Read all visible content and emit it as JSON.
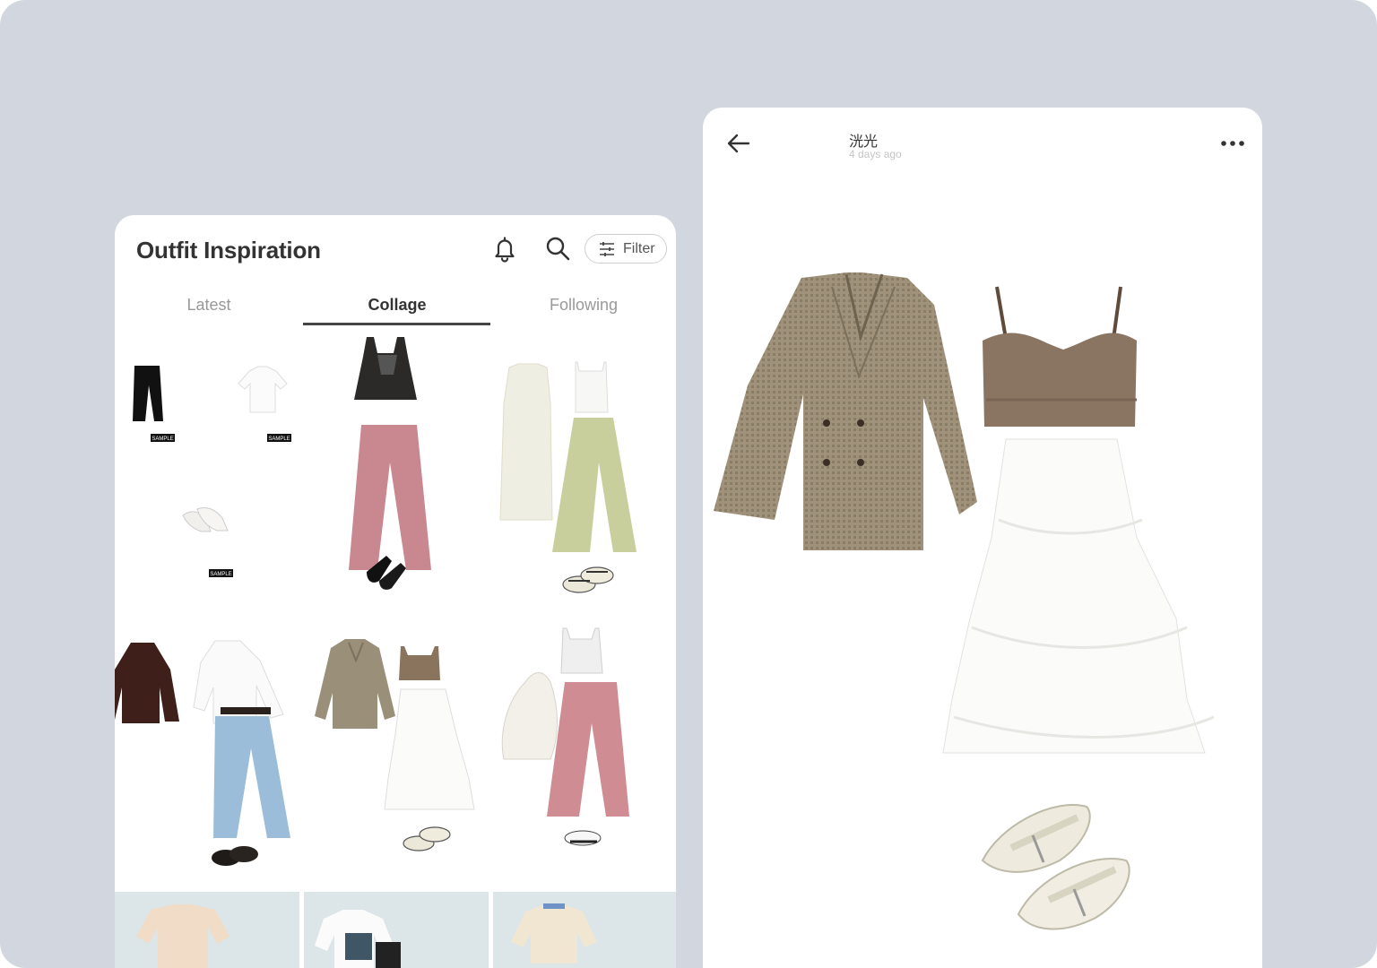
{
  "feed": {
    "title": "Outfit Inspiration",
    "header_icons": [
      "bell-icon",
      "search-icon",
      "sliders-icon"
    ],
    "filter_label": "Filter",
    "tabs": [
      {
        "label": "Latest",
        "active": false
      },
      {
        "label": "Collage",
        "active": true
      },
      {
        "label": "Following",
        "active": false
      }
    ],
    "sample_tag": "SAMPLE"
  },
  "detail": {
    "author": "洸光",
    "time": "4 days ago",
    "icons": [
      "arrow-left-icon",
      "more-horizontal-icon"
    ]
  },
  "colors": {
    "background": "#d1d6df",
    "card": "#ffffff",
    "title_text": "#333333",
    "tab_inactive": "#999999",
    "tab_indicator": "#444444",
    "muted_text": "#c5c5c5"
  }
}
